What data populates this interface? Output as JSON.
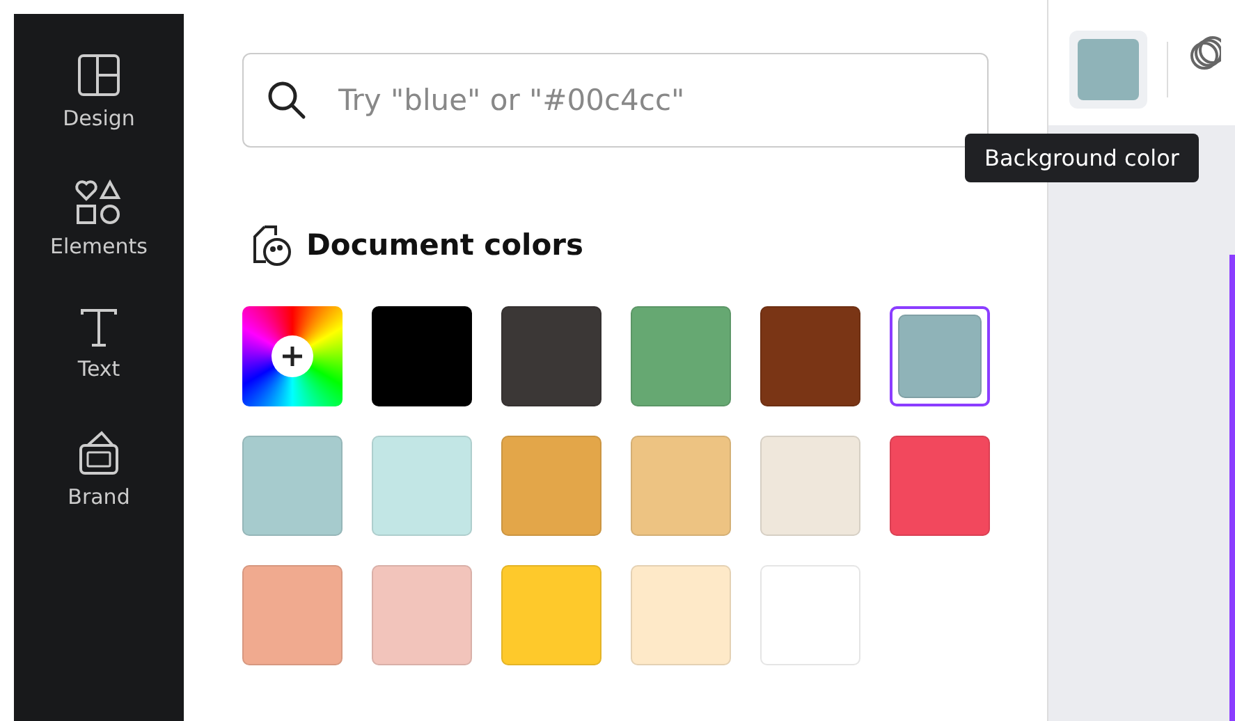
{
  "sidebar": {
    "items": [
      {
        "label": "Design",
        "kind": "design"
      },
      {
        "label": "Elements",
        "kind": "elements"
      },
      {
        "label": "Text",
        "kind": "text"
      },
      {
        "label": "Brand",
        "kind": "brand"
      }
    ]
  },
  "search": {
    "placeholder": "Try \"blue\" or \"#00c4cc\""
  },
  "section": {
    "title": "Document colors"
  },
  "swatches": [
    {
      "kind": "add",
      "selected": false
    },
    {
      "kind": "color",
      "color": "#000000",
      "selected": false
    },
    {
      "kind": "color",
      "color": "#3b3736",
      "selected": false
    },
    {
      "kind": "color",
      "color": "#66a872",
      "selected": false
    },
    {
      "kind": "color",
      "color": "#7a3515",
      "selected": false
    },
    {
      "kind": "color",
      "color": "#8fb3b8",
      "selected": true
    },
    {
      "kind": "color",
      "color": "#a6cbcd",
      "selected": false
    },
    {
      "kind": "color",
      "color": "#c2e6e5",
      "selected": false
    },
    {
      "kind": "color",
      "color": "#e3a649",
      "selected": false
    },
    {
      "kind": "color",
      "color": "#edc382",
      "selected": false
    },
    {
      "kind": "color",
      "color": "#efe7db",
      "selected": false
    },
    {
      "kind": "color",
      "color": "#f2485d",
      "selected": false
    },
    {
      "kind": "color",
      "color": "#f0aa8f",
      "selected": false
    },
    {
      "kind": "color",
      "color": "#f2c4bb",
      "selected": false
    },
    {
      "kind": "color",
      "color": "#fec92b",
      "selected": false
    },
    {
      "kind": "color",
      "color": "#fee9c8",
      "selected": false
    },
    {
      "kind": "color",
      "color": "#ffffff",
      "selected": false
    }
  ],
  "toolbar": {
    "tooltip": "Background color"
  }
}
